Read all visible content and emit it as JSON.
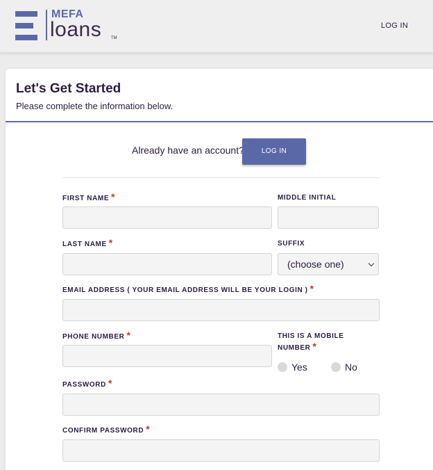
{
  "header": {
    "logo_mefa": "MEFA",
    "logo_loans": "loans",
    "logo_tm": "TM",
    "login_link": "LOG IN"
  },
  "card": {
    "title": "Let's Get Started",
    "subtitle": "Please complete the information below.",
    "already_text": "Already have an account?",
    "login_button": "LOG IN"
  },
  "form": {
    "first_name_label": "FIRST NAME",
    "middle_initial_label": "MIDDLE INITIAL",
    "last_name_label": "LAST NAME",
    "suffix_label": "SUFFIX",
    "suffix_value": "(choose one)",
    "email_label": "EMAIL ADDRESS ( YOUR EMAIL ADDRESS WILL BE YOUR LOGIN )",
    "phone_label": "PHONE NUMBER",
    "mobile_label_line1": "THIS IS A MOBILE",
    "mobile_label_line2": "NUMBER",
    "mobile_yes": "Yes",
    "mobile_no": "No",
    "password_label": "PASSWORD",
    "confirm_password_label": "CONFIRM PASSWORD",
    "required_mark": "*"
  },
  "colors": {
    "brand": "#5b68a8",
    "heading": "#2b1d3f",
    "required": "#c0392b"
  }
}
